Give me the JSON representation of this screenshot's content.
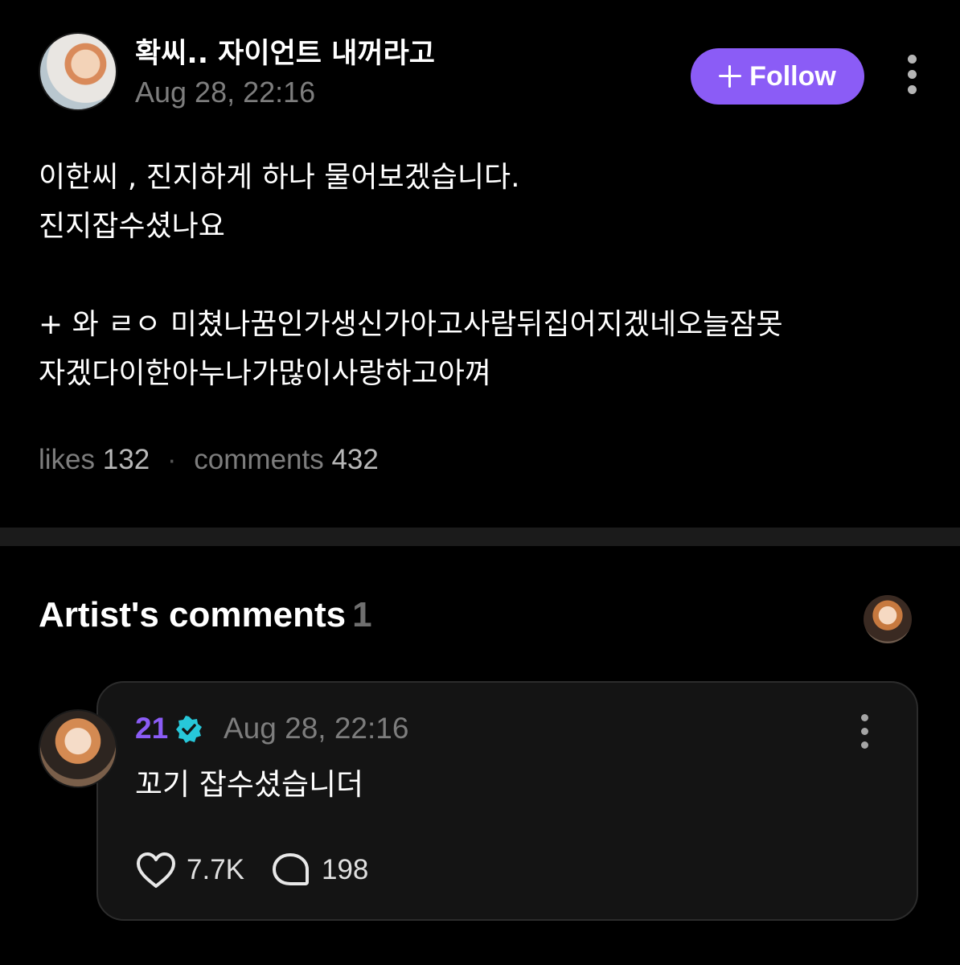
{
  "post": {
    "author_name": "확씨.. 자이언트 내꺼라고",
    "timestamp": "Aug 28, 22:16",
    "follow_label": "Follow",
    "body": "이한씨 , 진지하게 하나 물어보겠습니다.\n진지잡수셨나요\n\n+ 와 ㄹㅇ 미쳤나꿈인가생신가아고사람뒤집어지겠네오늘잠못\n자겠다이한아누나가많이사랑하고아껴",
    "likes_label": "likes",
    "likes_count": "132",
    "separator": "·",
    "comments_label": "comments",
    "comments_count": "432"
  },
  "artist_comments": {
    "title": "Artist's comments",
    "count": "1",
    "comment": {
      "author_name": "21",
      "timestamp": "Aug 28, 22:16",
      "text": "꼬기 잡수셨습니더",
      "likes": "7.7K",
      "replies": "198"
    }
  },
  "colors": {
    "background": "#000000",
    "accent": "#8b5cf6",
    "verified": "#27c7d9",
    "muted_text": "#7d7d7d",
    "card_background": "#141414"
  },
  "icons": [
    "plus-icon",
    "more-vertical-icon",
    "verified-badge-icon",
    "heart-icon",
    "comment-bubble-icon"
  ]
}
